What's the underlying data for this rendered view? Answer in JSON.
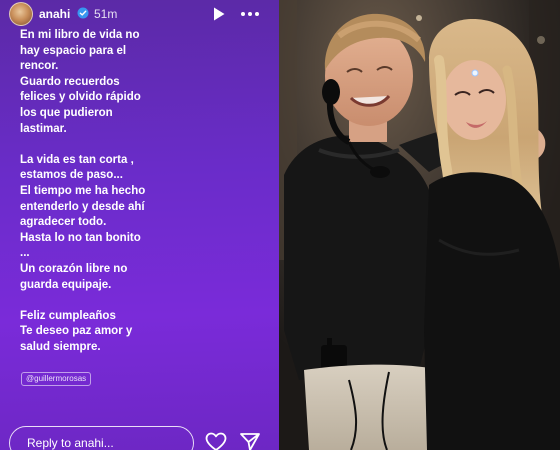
{
  "story": {
    "username": "anahi",
    "time_ago": "51m",
    "lines": [
      "En mi libro de vida no",
      "hay espacio para el",
      "rencor.",
      "Guardo recuerdos",
      "felices y olvido rápido",
      "los que pudieron",
      "lastimar.",
      "",
      "La vida es tan corta ,",
      "estamos de paso...",
      "El tiempo me ha hecho",
      "entenderlo y desde ahí",
      "agradecer todo.",
      "Hasta lo no tan bonito",
      "...",
      "Un corazón libre no",
      "guarda equipaje.",
      "",
      "Feliz cumpleaños",
      "Te deseo paz amor y",
      "salud siempre."
    ],
    "mention": "@guillermorosas",
    "reply_placeholder": "Reply to anahi..."
  },
  "icons": {
    "verified": "verified-badge-icon",
    "play": "play-icon",
    "more": "more-horizontal-icon",
    "heart": "heart-icon",
    "send": "send-icon"
  },
  "colors": {
    "story_gradient_top": "#5b2aa6",
    "story_gradient_bottom": "#7a2bd9",
    "verified_blue": "#3897f0"
  }
}
